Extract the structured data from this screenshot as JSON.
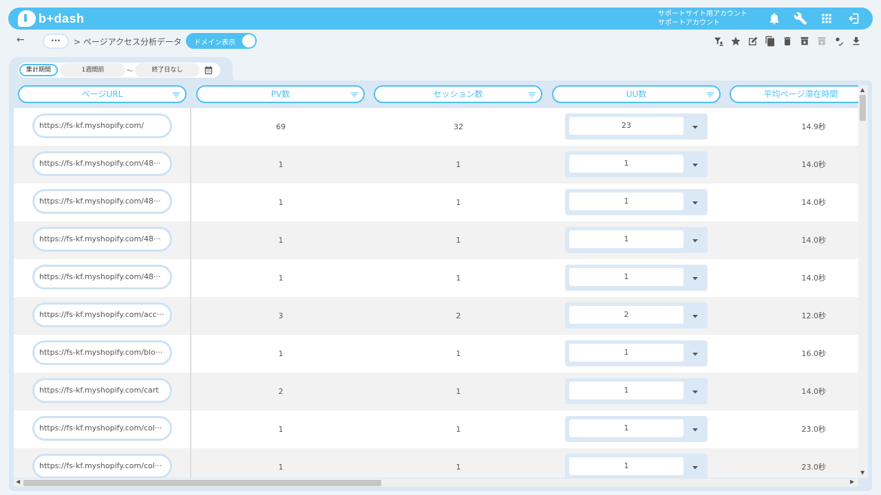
{
  "header": {
    "logo_text": "b+dash",
    "account_line1": "サポートサイト用アカウント",
    "account_line2": "サポートアカウント"
  },
  "toolbar": {
    "back": "←",
    "more": "···",
    "breadcrumb": "> ページアクセス分析データ",
    "domain_toggle": "ドメイン表示"
  },
  "period": {
    "label": "集計期間",
    "start": "1週間前",
    "separator": "～",
    "end": "終了日なし"
  },
  "columns": [
    "ページURL",
    "PV数",
    "セッション数",
    "UU数",
    "平均ページ滞在時間"
  ],
  "rows": [
    {
      "url": "https://fs-kf.myshopify.com/",
      "pv": "69",
      "sessions": "32",
      "uu": "23",
      "avg_time": "14.9秒"
    },
    {
      "url": "https://fs-kf.myshopify.com/48···",
      "pv": "1",
      "sessions": "1",
      "uu": "1",
      "avg_time": "14.0秒"
    },
    {
      "url": "https://fs-kf.myshopify.com/48···",
      "pv": "1",
      "sessions": "1",
      "uu": "1",
      "avg_time": "14.0秒"
    },
    {
      "url": "https://fs-kf.myshopify.com/48···",
      "pv": "1",
      "sessions": "1",
      "uu": "1",
      "avg_time": "14.0秒"
    },
    {
      "url": "https://fs-kf.myshopify.com/48···",
      "pv": "1",
      "sessions": "1",
      "uu": "1",
      "avg_time": "14.0秒"
    },
    {
      "url": "https://fs-kf.myshopify.com/acc···",
      "pv": "3",
      "sessions": "2",
      "uu": "2",
      "avg_time": "12.0秒"
    },
    {
      "url": "https://fs-kf.myshopify.com/blo···",
      "pv": "1",
      "sessions": "1",
      "uu": "1",
      "avg_time": "16.0秒"
    },
    {
      "url": "https://fs-kf.myshopify.com/cart",
      "pv": "2",
      "sessions": "1",
      "uu": "1",
      "avg_time": "14.0秒"
    },
    {
      "url": "https://fs-kf.myshopify.com/col···",
      "pv": "1",
      "sessions": "1",
      "uu": "1",
      "avg_time": "23.0秒"
    },
    {
      "url": "https://fs-kf.myshopify.com/col···",
      "pv": "1",
      "sessions": "1",
      "uu": "1",
      "avg_time": "23.0秒"
    }
  ],
  "colors": {
    "accent": "#4fc0f2",
    "panel": "#d9e8f4"
  }
}
